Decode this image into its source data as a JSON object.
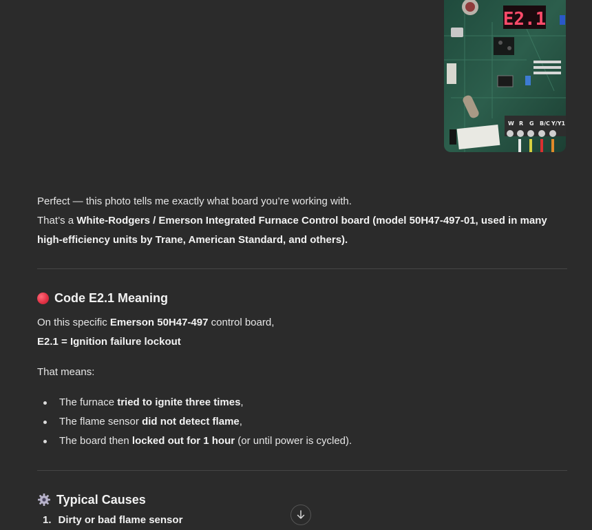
{
  "photo": {
    "alt": "Furnace control board photo",
    "display_code": "E2.1",
    "terminal_labels": [
      "W",
      "R",
      "G",
      "B/C",
      "Y/Y1"
    ]
  },
  "intro": {
    "line1": "Perfect — this photo tells me exactly what board you’re working with.",
    "line2_prefix": "That’s a ",
    "line2_bold": "White-Rodgers / Emerson Integrated Furnace Control board (model 50H47-497-01, used in many high-efficiency units by Trane, American Standard, and others)."
  },
  "section1": {
    "title": "Code E2.1 Meaning",
    "board_prefix": "On this specific ",
    "board_bold": "Emerson 50H47-497",
    "board_suffix": " control board,",
    "code_line": "E2.1 = Ignition failure lockout",
    "that_means": "That means:",
    "bullets": [
      {
        "pre": "The furnace ",
        "bold": "tried to ignite three times",
        "post": ","
      },
      {
        "pre": "The flame sensor ",
        "bold": "did not detect flame",
        "post": ","
      },
      {
        "pre": "The board then ",
        "bold": "locked out for 1 hour",
        "post": " (or until power is cycled)."
      }
    ]
  },
  "section2": {
    "title": "Typical Causes",
    "items": [
      {
        "num": "1.",
        "text": "Dirty or bad flame sensor"
      }
    ]
  },
  "icons": {
    "section1_icon": "red-circle-icon",
    "section2_icon": "gear-icon",
    "scroll_icon": "arrow-down-icon"
  },
  "colors": {
    "background": "#2b2b2b",
    "text": "#e6e6e6",
    "divider": "#464646",
    "red_dot": "#e33346"
  }
}
